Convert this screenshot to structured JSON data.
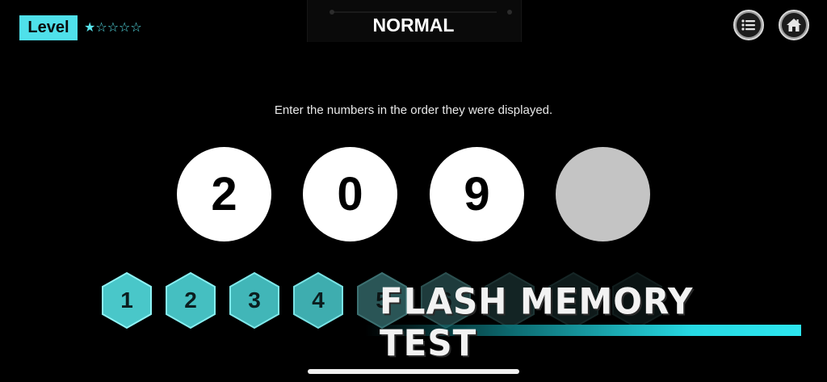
{
  "header": {
    "level_label": "Level",
    "level_stars": "★☆☆☆☆",
    "mode_title": "NORMAL",
    "menu_icon": "list-icon",
    "home_icon": "home-icon"
  },
  "instruction": "Enter the numbers in the order they were displayed.",
  "answer_slots": [
    "2",
    "0",
    "9",
    ""
  ],
  "keypad": {
    "keys": [
      "1",
      "2",
      "3",
      "4",
      "5",
      "6"
    ],
    "active_color": "#49c7c9",
    "dim_color": "#1e3b3c"
  },
  "banner": {
    "title": "FLASH MEMORY TEST",
    "accent_color": "#2de6ef"
  }
}
